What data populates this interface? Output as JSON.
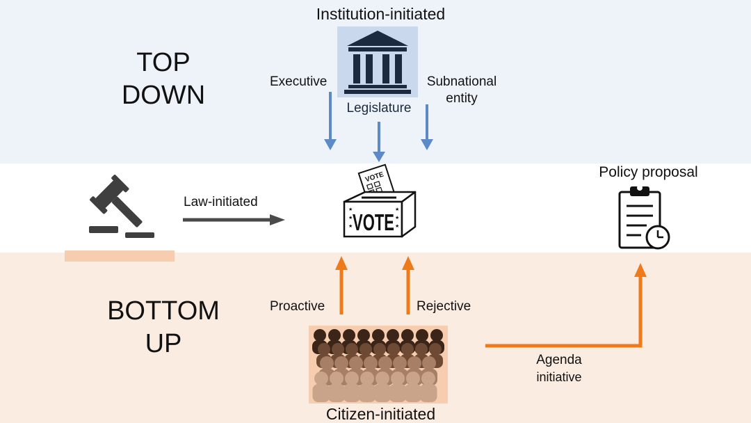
{
  "sections": {
    "top_line1": "TOP",
    "top_line2": "DOWN",
    "bottom_line1": "BOTTOM",
    "bottom_line2": "UP"
  },
  "nodes": {
    "institution": "Institution-initiated",
    "legislature": "Legislature",
    "executive": "Executive",
    "subnational_line1": "Subnational",
    "subnational_line2": "entity",
    "law": "Law-initiated",
    "policy": "Policy proposal",
    "proactive": "Proactive",
    "rejective": "Rejective",
    "agenda_line1": "Agenda",
    "agenda_line2": "initiative",
    "citizen": "Citizen-initiated"
  },
  "ballot": {
    "box_text": "VOTE",
    "paper_text": "VOTE"
  },
  "icons": [
    "institution-building-icon",
    "gavel-icon",
    "ballot-box-icon",
    "clipboard-clock-icon",
    "crowd-icon"
  ],
  "colors": {
    "top_band": "#eef3f9",
    "bottom_band": "#fbece1",
    "blue_arrow": "#5b8ac6",
    "orange_arrow": "#f07a1a",
    "gray_arrow": "#4a4a4a",
    "building_bg": "#c9d8ec",
    "crowd_bg": "#f7cdb0"
  }
}
